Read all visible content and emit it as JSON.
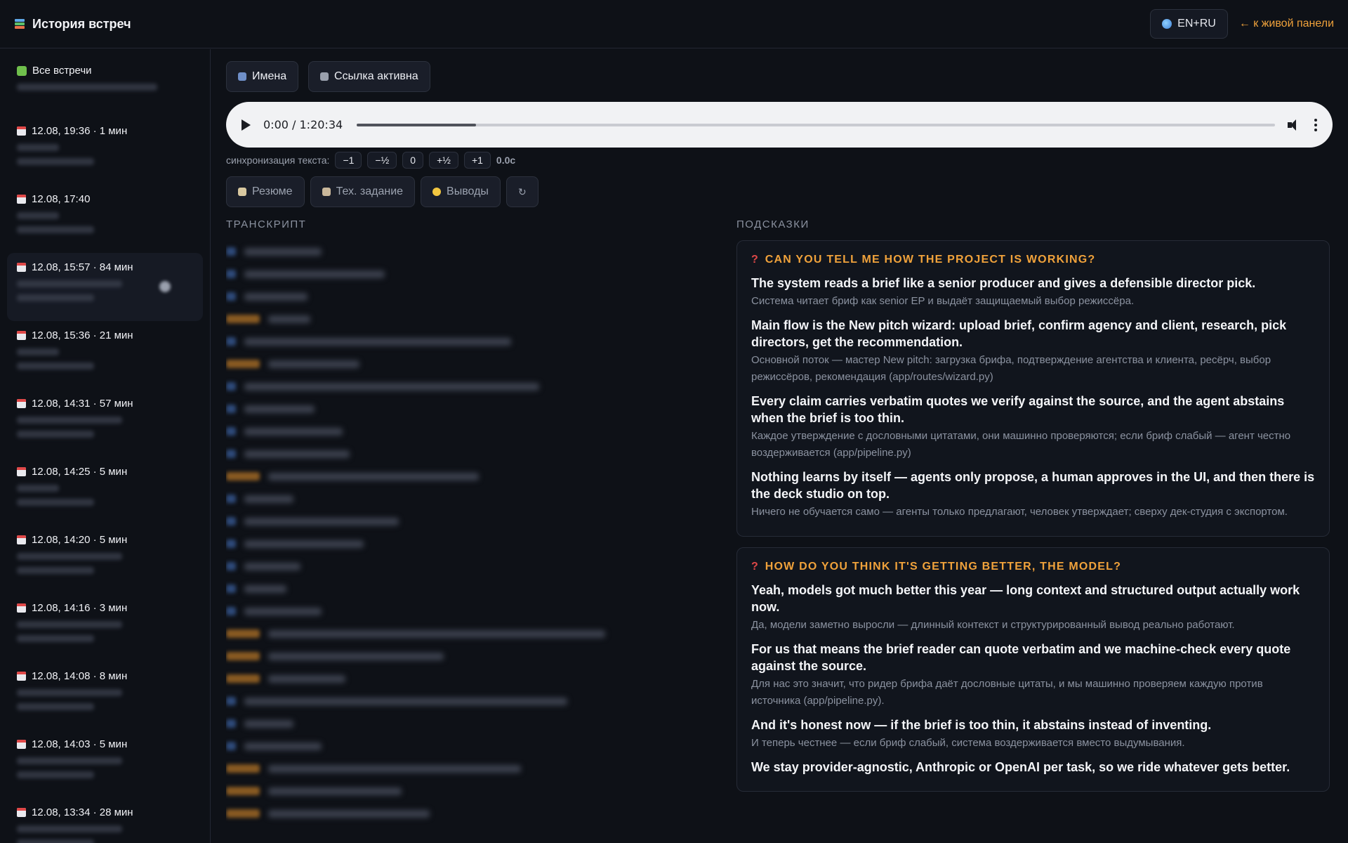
{
  "header": {
    "title": "История встреч",
    "lang_button": "EN+RU",
    "back_link": "← к живой панели"
  },
  "sidebar": {
    "items": [
      {
        "label": "Все встречи",
        "icon": "puzzle-icon"
      },
      {
        "label": "12.08, 19:36 · 1 мин",
        "icon": "calendar-icon"
      },
      {
        "label": "12.08, 17:40",
        "icon": "calendar-icon"
      },
      {
        "label": "12.08, 15:57 · 84 мин",
        "icon": "calendar-icon"
      },
      {
        "label": "12.08, 15:36 · 21 мин",
        "icon": "calendar-icon"
      },
      {
        "label": "12.08, 14:31 · 57 мин",
        "icon": "calendar-icon"
      },
      {
        "label": "12.08, 14:25 · 5 мин",
        "icon": "calendar-icon"
      },
      {
        "label": "12.08, 14:20 · 5 мин",
        "icon": "calendar-icon"
      },
      {
        "label": "12.08, 14:16 · 3 мин",
        "icon": "calendar-icon"
      },
      {
        "label": "12.08, 14:08 · 8 мин",
        "icon": "calendar-icon"
      },
      {
        "label": "12.08, 14:03 · 5 мин",
        "icon": "calendar-icon"
      },
      {
        "label": "12.08, 13:34 · 28 мин",
        "icon": "calendar-icon"
      }
    ]
  },
  "toolbar": {
    "names_button": "Имена",
    "link_button": "Ссылка активна"
  },
  "player": {
    "time": "0:00 / 1:20:34",
    "progress": 0.13
  },
  "sync": {
    "label": "синхронизация текста:",
    "chips": [
      "−1",
      "−½",
      "0",
      "+½",
      "+1"
    ],
    "value": "0.0с"
  },
  "actions": {
    "summary": "Резюме",
    "spec": "Тех. задание",
    "conclusions": "Выводы",
    "refresh": "↻"
  },
  "sections": {
    "transcript": "ТРАНСКРИПТ",
    "hints": "ПОДСКАЗКИ"
  },
  "hints": [
    {
      "question": "CAN YOU TELL ME HOW THE PROJECT IS WORKING?",
      "answers": [
        {
          "en": "The system reads a brief like a senior producer and gives a defensible director pick.",
          "ru": "Система читает бриф как senior EP и выдаёт защищаемый выбор режиссёра."
        },
        {
          "en": "Main flow is the New pitch wizard: upload brief, confirm agency and client, research, pick directors, get the recommendation.",
          "ru": "Основной поток — мастер New pitch: загрузка брифа, подтверждение агентства и клиента, ресёрч, выбор режиссёров, рекомендация (app/routes/wizard.py)"
        },
        {
          "en": "Every claim carries verbatim quotes we verify against the source, and the agent abstains when the brief is too thin.",
          "ru": "Каждое утверждение с дословными цитатами, они машинно проверяются; если бриф слабый — агент честно воздерживается (app/pipeline.py)"
        },
        {
          "en": "Nothing learns by itself — agents only propose, a human approves in the UI, and then there is the deck studio on top.",
          "ru": "Ничего не обучается само — агенты только предлагают, человек утверждает; сверху дек-студия с экспортом."
        }
      ]
    },
    {
      "question": "HOW DO YOU THINK IT'S GETTING BETTER, THE MODEL?",
      "answers": [
        {
          "en": "Yeah, models got much better this year — long context and structured output actually work now.",
          "ru": "Да, модели заметно выросли — длинный контекст и структурированный вывод реально работают."
        },
        {
          "en": "For us that means the brief reader can quote verbatim and we machine-check every quote against the source.",
          "ru": "Для нас это значит, что ридер брифа даёт дословные цитаты, и мы машинно проверяем каждую против источника (app/pipeline.py)."
        },
        {
          "en": "And it's honest now — if the brief is too thin, it abstains instead of inventing.",
          "ru": "И теперь честнее — если бриф слабый, система воздерживается вместо выдумывания."
        },
        {
          "en": "We stay provider-agnostic, Anthropic or OpenAI per task, so we ride whatever gets better.",
          "ru": ""
        }
      ]
    }
  ]
}
